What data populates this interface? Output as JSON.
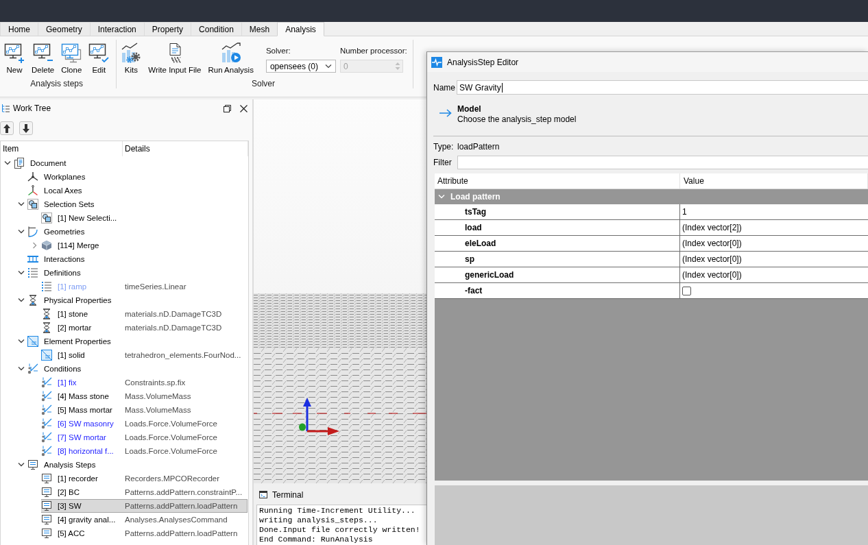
{
  "tabs": [
    {
      "label": "Home",
      "selected": false
    },
    {
      "label": "Geometry",
      "selected": false
    },
    {
      "label": "Interaction",
      "selected": false
    },
    {
      "label": "Property",
      "selected": false
    },
    {
      "label": "Condition",
      "selected": false
    },
    {
      "label": "Mesh",
      "selected": false
    },
    {
      "label": "Analysis",
      "selected": true
    }
  ],
  "ribbon": {
    "groups": [
      {
        "label": "Analysis steps",
        "buttons": [
          {
            "label": "New",
            "kind": "new"
          },
          {
            "label": "Delete",
            "kind": "delete"
          },
          {
            "label": "Clone",
            "kind": "clone"
          },
          {
            "label": "Edit",
            "kind": "edit"
          }
        ]
      },
      {
        "label": "Solver",
        "buttons": [
          {
            "label": "Kits",
            "kind": "kits"
          },
          {
            "label": "Write Input File",
            "kind": "write"
          },
          {
            "label": "Run Analysis",
            "kind": "run"
          }
        ],
        "solver": {
          "label": "Solver:",
          "value": "opensees (0)"
        },
        "processors": {
          "label": "Number processor:",
          "value": "0",
          "disabled": true
        }
      }
    ]
  },
  "work_tree": {
    "title": "Work Tree",
    "columns": [
      "Item",
      "Details"
    ],
    "items": [
      {
        "label": "Document",
        "kind": "document",
        "expanded": true,
        "selected": false,
        "children": [
          {
            "label": "Workplanes",
            "kind": "workplane",
            "selected": false
          },
          {
            "label": "Local Axes",
            "kind": "axes",
            "selected": false
          },
          {
            "label": "Selection Sets",
            "kind": "selection",
            "expanded": true,
            "selected": false,
            "children": [
              {
                "label": "[1] New Selecti...",
                "kind": "selection",
                "selected": false
              }
            ]
          },
          {
            "label": "Geometries",
            "kind": "geometry",
            "expanded": true,
            "selected": false,
            "children": [
              {
                "label": "[114] Merge",
                "kind": "mesh",
                "expanded": false,
                "selected": false
              }
            ]
          },
          {
            "label": "Interactions",
            "kind": "interaction",
            "selected": false
          },
          {
            "label": "Definitions",
            "kind": "definition",
            "expanded": true,
            "selected": false,
            "children": [
              {
                "label": "[1] ramp",
                "details": "timeSeries.Linear",
                "kind": "definition",
                "color": "#7c9cf4",
                "selected": false
              }
            ]
          },
          {
            "label": "Physical Properties",
            "kind": "material",
            "expanded": true,
            "selected": false,
            "children": [
              {
                "label": "[1] stone",
                "details": "materials.nD.DamageTC3D",
                "kind": "material",
                "selected": false
              },
              {
                "label": "[2] mortar",
                "details": "materials.nD.DamageTC3D",
                "kind": "material",
                "selected": false
              }
            ]
          },
          {
            "label": "Element Properties",
            "kind": "element",
            "expanded": true,
            "selected": false,
            "children": [
              {
                "label": "[1] solid",
                "details": "tetrahedron_elements.FourNod...",
                "kind": "element",
                "selected": false
              }
            ]
          },
          {
            "label": "Conditions",
            "kind": "condition",
            "expanded": true,
            "selected": false,
            "children": [
              {
                "label": "[1] fix",
                "details": "Constraints.sp.fix",
                "kind": "condition",
                "color": "#1f1fff",
                "selected": false
              },
              {
                "label": "[4] Mass stone",
                "details": "Mass.VolumeMass",
                "kind": "condition",
                "selected": false
              },
              {
                "label": "[5] Mass mortar",
                "details": "Mass.VolumeMass",
                "kind": "condition",
                "selected": false
              },
              {
                "label": "[6] SW masonry",
                "details": "Loads.Force.VolumeForce",
                "kind": "condition",
                "color": "#1f1fff",
                "selected": false
              },
              {
                "label": "[7] SW mortar",
                "details": "Loads.Force.VolumeForce",
                "kind": "condition",
                "color": "#1f1fff",
                "selected": false
              },
              {
                "label": "[8] horizontal f...",
                "details": "Loads.Force.VolumeForce",
                "kind": "condition",
                "color": "#1f1fff",
                "selected": false
              }
            ]
          },
          {
            "label": "Analysis Steps",
            "kind": "analysis",
            "expanded": true,
            "selected": false,
            "children": [
              {
                "label": "[1] recorder",
                "details": "Recorders.MPCORecorder",
                "kind": "analysis",
                "selected": false
              },
              {
                "label": "[2] BC",
                "details": "Patterns.addPattern.constraintP...",
                "kind": "analysis",
                "selected": false
              },
              {
                "label": "[3] SW",
                "details": "Patterns.addPattern.loadPattern",
                "kind": "analysis",
                "selected": true
              },
              {
                "label": "[4] gravity anal...",
                "details": "Analyses.AnalysesCommand",
                "kind": "analysis",
                "selected": false
              },
              {
                "label": "[5] ACC",
                "details": "Patterns.addPattern.loadPattern",
                "kind": "analysis",
                "selected": false
              }
            ]
          }
        ]
      }
    ]
  },
  "terminal": {
    "title": "Terminal",
    "lines": [
      "Running Time-Increment Utility...",
      "writing analysis_steps...",
      "Done.Input file correctly written!",
      "End Command: RunAnalysis"
    ]
  },
  "editor": {
    "title": "AnalysisStep Editor",
    "name_field": {
      "label": "Name",
      "value": "SW Gravity",
      "focused": true
    },
    "section": {
      "title": "Model",
      "subtitle": "Choose the analysis_step model"
    },
    "type": {
      "label": "Type:",
      "value": "loadPattern"
    },
    "filter": {
      "label": "Filter"
    },
    "table": {
      "columns": [
        "Attribute",
        "Value"
      ],
      "groups": [
        {
          "label": "Load pattern",
          "expanded": true,
          "rows": [
            {
              "attribute": "tsTag",
              "kind": "text",
              "value": "1"
            },
            {
              "attribute": "load",
              "kind": "text",
              "value": "(Index vector[2])"
            },
            {
              "attribute": "eleLoad",
              "kind": "text",
              "value": "(Index vector[0])"
            },
            {
              "attribute": "sp",
              "kind": "text",
              "value": "(Index vector[0])"
            },
            {
              "attribute": "genericLoad",
              "kind": "text",
              "value": "(Index vector[0])"
            },
            {
              "attribute": "-fact",
              "kind": "checkbox",
              "checked": false
            }
          ]
        }
      ]
    }
  }
}
